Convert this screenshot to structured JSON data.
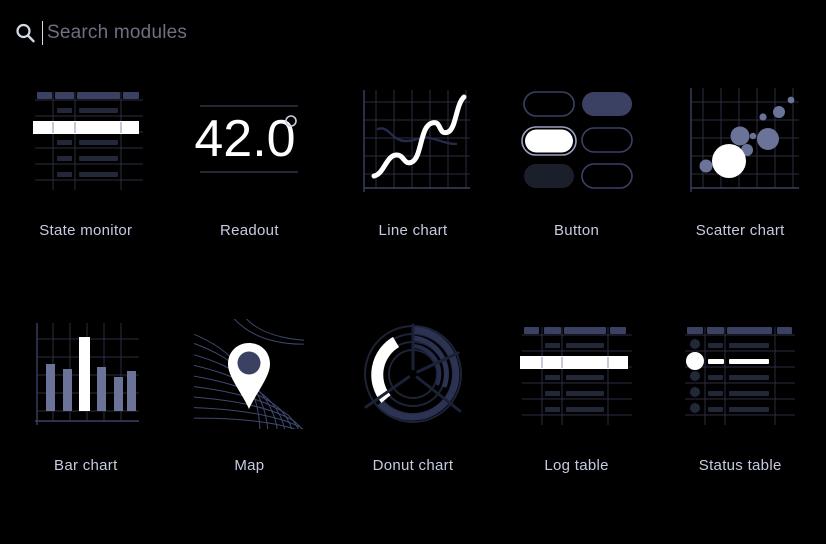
{
  "search": {
    "placeholder": "Search modules",
    "value": "",
    "icon": "search-icon"
  },
  "palette": {
    "background": "#000000",
    "accent_blue": "#6b7399",
    "deep_blue": "#3b4163",
    "grid_line": "#2a2d40",
    "highlight": "#ffffff",
    "label": "#c6cbe0",
    "placeholder": "#6d7082"
  },
  "modules": [
    {
      "id": "state-monitor",
      "label": "State monitor",
      "preview": "table"
    },
    {
      "id": "readout",
      "label": "Readout",
      "preview": "readout",
      "value": "42.0",
      "unit": "°"
    },
    {
      "id": "line-chart",
      "label": "Line chart",
      "preview": "line"
    },
    {
      "id": "button",
      "label": "Button",
      "preview": "button"
    },
    {
      "id": "scatter-chart",
      "label": "Scatter chart",
      "preview": "scatter"
    },
    {
      "id": "bar-chart",
      "label": "Bar chart",
      "preview": "bar"
    },
    {
      "id": "map",
      "label": "Map",
      "preview": "map"
    },
    {
      "id": "donut-chart",
      "label": "Donut chart",
      "preview": "donut"
    },
    {
      "id": "log-table",
      "label": "Log table",
      "preview": "table"
    },
    {
      "id": "status-table",
      "label": "Status table",
      "preview": "status-table"
    }
  ]
}
